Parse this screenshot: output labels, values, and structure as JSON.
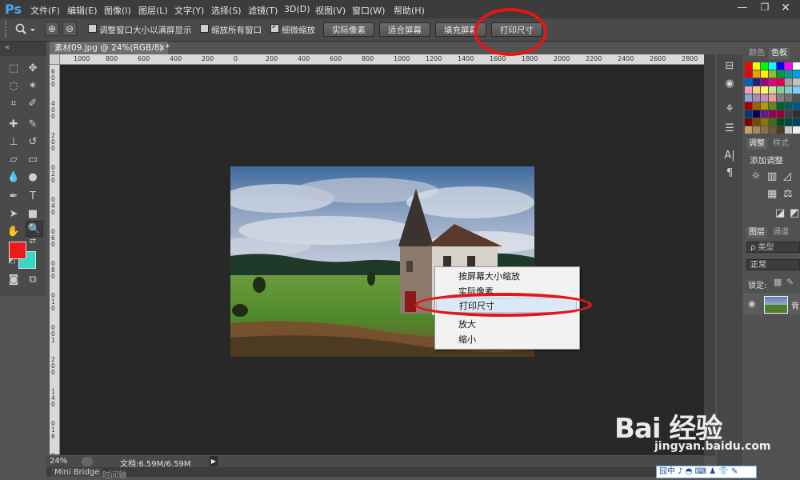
{
  "app": {
    "logo": "Ps",
    "menu": [
      "文件(F)",
      "编辑(E)",
      "图像(I)",
      "图层(L)",
      "文字(Y)",
      "选择(S)",
      "滤镜(T)",
      "3D(D)",
      "视图(V)",
      "窗口(W)",
      "帮助(H)"
    ],
    "window_controls": {
      "minimize": "—",
      "maximize": "❐",
      "close": "✕"
    }
  },
  "options": {
    "zoom_in": "⊕",
    "zoom_out": "⊖",
    "resize_windows": "调整窗口大小以满屏显示",
    "zoom_all": "缩放所有窗口",
    "scrubby_zoom": "细微缩放",
    "scrubby_checked": true,
    "actual_pixels": "实际像素",
    "fit_screen": "适合屏幕",
    "fill_screen": "填充屏幕",
    "print_size": "打印尺寸"
  },
  "document": {
    "tab_title": "素材09.jpg @ 24%(RGB/8) *",
    "tab_close": "×",
    "ruler_top": [
      "1000",
      "800",
      "600",
      "400",
      "200",
      "0",
      "200",
      "400",
      "600",
      "800",
      "1000",
      "1200",
      "1400",
      "1600",
      "1800",
      "2000",
      "2200",
      "2400",
      "2600",
      "2800"
    ],
    "ruler_left": [
      "6",
      "0",
      "0",
      "4",
      "0",
      "0",
      "2",
      "0",
      "0",
      "0",
      "2",
      "0",
      "0",
      "4",
      "0",
      "0",
      "6",
      "0",
      "0",
      "8",
      "0",
      "0",
      "1",
      "0",
      "0",
      "0",
      "1",
      "2",
      "0",
      "0",
      "1",
      "4",
      "0",
      "0",
      "1",
      "6",
      "0",
      "0"
    ]
  },
  "context_menu": {
    "items": [
      "按屏幕大小缩放",
      "实际像素",
      "打印尺寸",
      "放大",
      "缩小"
    ],
    "highlighted": "打印尺寸"
  },
  "status": {
    "zoom": "24%",
    "doc_info": "文档:6.59M/6.59M",
    "arrow": "▶"
  },
  "panel_tabs": {
    "bottom": [
      "Mini Bridge",
      "时间轴"
    ],
    "color": [
      "颜色",
      "色板"
    ],
    "adjust": [
      "调整",
      "样式"
    ],
    "adjust_title": "添加调整",
    "layers": [
      "图层",
      "通道"
    ],
    "layer_kind": "ρ 类型",
    "blend_mode": "正常",
    "lock_label": "锁定:",
    "layer_name": "背"
  },
  "watermark": {
    "logo": "Bai 经验",
    "url": "jingyan.baidu.com"
  },
  "ime": "囧中 ♪ ◓ ⌨ ♟ 👕 ✎",
  "colors": {
    "accent_red": "#e51616",
    "fg": "#ee1a1a",
    "bg": "#34d8c6",
    "ps_blue": "#46a8f5"
  }
}
